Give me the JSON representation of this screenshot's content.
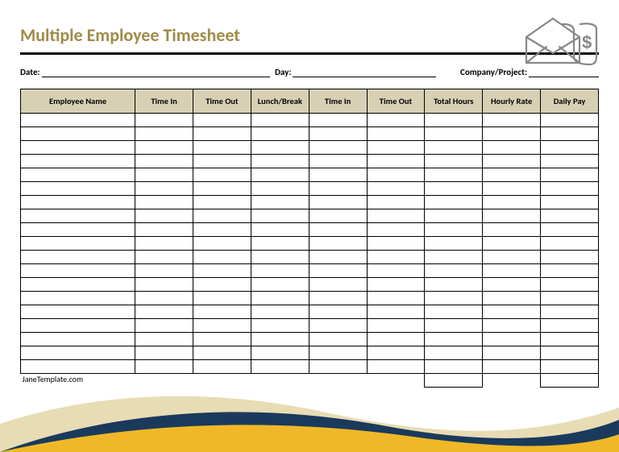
{
  "title": "Multiple Employee Timesheet",
  "meta": {
    "date_label": "Date:",
    "day_label": "Day:",
    "company_label": "Company/Project:",
    "date_value": "",
    "day_value": "",
    "company_value": ""
  },
  "columns": [
    "Employee Name",
    "Time In",
    "Time Out",
    "Lunch/Break",
    "Time In",
    "Time Out",
    "Total Hours",
    "Hourly Rate",
    "Daily Pay"
  ],
  "rows": 19,
  "footer": {
    "source": "JaneTemplate.com",
    "total_hours_sum": "",
    "daily_pay_sum": ""
  },
  "icon": {
    "name": "envelope-money-icon",
    "symbol": "$"
  }
}
